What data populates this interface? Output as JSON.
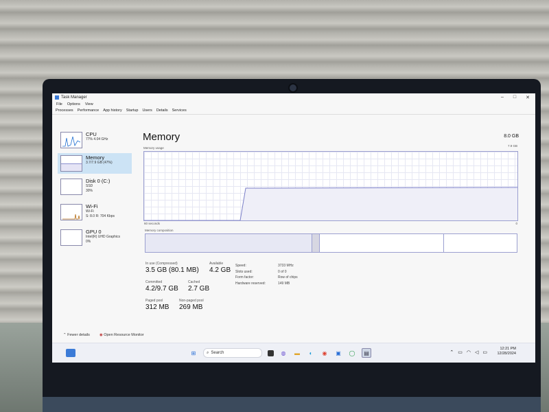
{
  "window": {
    "title": "Task Manager",
    "controls": [
      "–",
      "□",
      "✕"
    ]
  },
  "menu": [
    "File",
    "Options",
    "View"
  ],
  "tabs": [
    "Processes",
    "Performance",
    "App history",
    "Startup",
    "Users",
    "Details",
    "Services"
  ],
  "sidebar": {
    "items": [
      {
        "name": "CPU",
        "line1": "77% 4.04 GHz",
        "line2": ""
      },
      {
        "name": "Memory",
        "line1": "3.7/7.9 GB (47%)",
        "line2": ""
      },
      {
        "name": "Disk 0 (C:)",
        "line1": "SSD",
        "line2": "30%"
      },
      {
        "name": "Wi-Fi",
        "line1": "Wi-Fi",
        "line2": "S: 8.0 R: 704 Kbps"
      },
      {
        "name": "GPU 0",
        "line1": "Intel(R) UHD Graphics",
        "line2": "0%"
      }
    ]
  },
  "main": {
    "title": "Memory",
    "capacity": "8.0 GB",
    "usage_label": "Memory usage",
    "usage_max": "7.9 GB",
    "time_left": "60 seconds",
    "time_right": "0",
    "composition_label": "Memory composition",
    "stats": {
      "in_use_label": "In use (Compressed)",
      "in_use": "3.5 GB (80.1 MB)",
      "available_label": "Available",
      "available": "4.2 GB",
      "committed_label": "Committed",
      "committed": "4.2/9.7 GB",
      "cached_label": "Cached",
      "cached": "2.7 GB",
      "paged_label": "Paged pool",
      "paged": "312 MB",
      "nonpaged_label": "Non-paged pool",
      "nonpaged": "269 MB"
    },
    "details": [
      {
        "k": "Speed:",
        "v": "3733 MHz"
      },
      {
        "k": "Slots used:",
        "v": "0 of 0"
      },
      {
        "k": "Form factor:",
        "v": "Row of chips"
      },
      {
        "k": "Hardware reserved:",
        "v": "149 MB"
      }
    ],
    "usage_series": {
      "unit": "fraction of total",
      "pre_level": 0.0,
      "level": 0.47
    }
  },
  "footer": {
    "fewer": "Fewer details",
    "monitor": "Open Resource Monitor"
  },
  "taskbar": {
    "search": "Search",
    "time": "12:21 PM",
    "date": "12/28/2024"
  }
}
